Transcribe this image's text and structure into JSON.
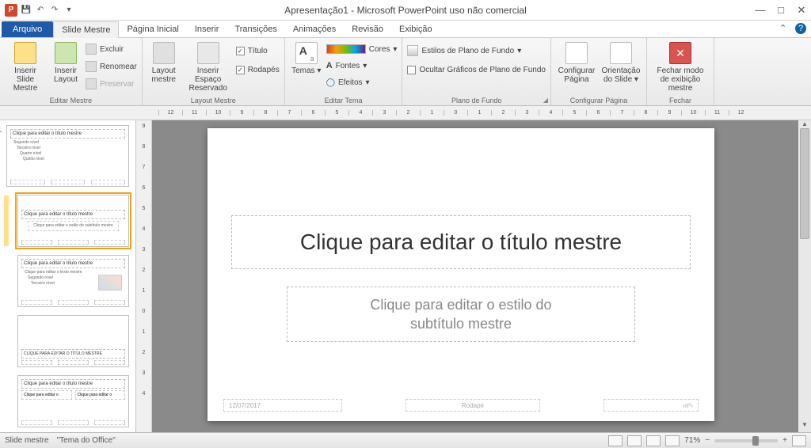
{
  "titlebar": {
    "appicon": "P",
    "title": "Apresentação1 - Microsoft PowerPoint uso não comercial"
  },
  "tabs": {
    "file": "Arquivo",
    "items": [
      "Slide Mestre",
      "Página Inicial",
      "Inserir",
      "Transições",
      "Animações",
      "Revisão",
      "Exibição"
    ],
    "active_index": 0
  },
  "ribbon": {
    "g1": {
      "label": "Editar Mestre",
      "insert_slide": "Inserir Slide Mestre",
      "insert_layout": "Inserir Layout",
      "delete": "Excluir",
      "rename": "Renomear",
      "preserve": "Preservar"
    },
    "g2": {
      "label": "Layout Mestre",
      "layout_master": "Layout mestre",
      "insert_placeholder": "Inserir Espaço Reservado",
      "title": "Título",
      "footers": "Rodapés"
    },
    "g3": {
      "label": "Editar Tema",
      "themes": "Temas",
      "colors": "Cores",
      "fonts": "Fontes",
      "effects": "Efeitos"
    },
    "g4": {
      "label": "Plano de Fundo",
      "bg_styles": "Estilos de Plano de Fundo",
      "hide_bg": "Ocultar Gráficos de Plano de Fundo"
    },
    "g5": {
      "label": "Configurar Página",
      "page_setup": "Configurar Página",
      "orientation": "Orientação do Slide"
    },
    "g6": {
      "label": "Fechar",
      "close": "Fechar modo de exibição mestre"
    }
  },
  "ruler_h": [
    "12",
    "11",
    "10",
    "9",
    "8",
    "7",
    "6",
    "5",
    "4",
    "3",
    "2",
    "1",
    "0",
    "1",
    "2",
    "3",
    "4",
    "5",
    "6",
    "7",
    "8",
    "9",
    "10",
    "11",
    "12"
  ],
  "ruler_v": [
    "9",
    "8",
    "7",
    "6",
    "5",
    "4",
    "3",
    "2",
    "1",
    "0",
    "1",
    "2",
    "3",
    "4"
  ],
  "thumbs": {
    "t1": {
      "title": "Clique para editar o título mestre",
      "lines": [
        "Segundo nível",
        "Terceiro nível",
        "Quarto nível",
        "Quinto nível"
      ]
    },
    "t2": {
      "title": "Clique para editar o título mestre",
      "sub": "Clique para editar o estilo do subtítulo mestre"
    },
    "t3": {
      "title": "Clique para editar o título mestre",
      "lines": [
        "Clique para editar o texto mestre",
        "Segundo nível",
        "Terceiro nível"
      ]
    },
    "t4": {
      "title": "CLIQUE PARA EDITAR O TÍTULO MESTRE"
    },
    "t5": {
      "title": "Clique para editar o título mestre",
      "left": "Clique para editar o",
      "right": "Clique para editar o"
    }
  },
  "slide": {
    "title_ph": "Clique para editar o título mestre",
    "subtitle_ph1": "Clique para editar o estilo do",
    "subtitle_ph2": "subtítulo mestre",
    "date": "12/07/2017",
    "footer": "Rodapé",
    "num": "‹nº›"
  },
  "status": {
    "left1": "Slide mestre",
    "left2": "\"Tema do Office\"",
    "zoom": "71%"
  }
}
